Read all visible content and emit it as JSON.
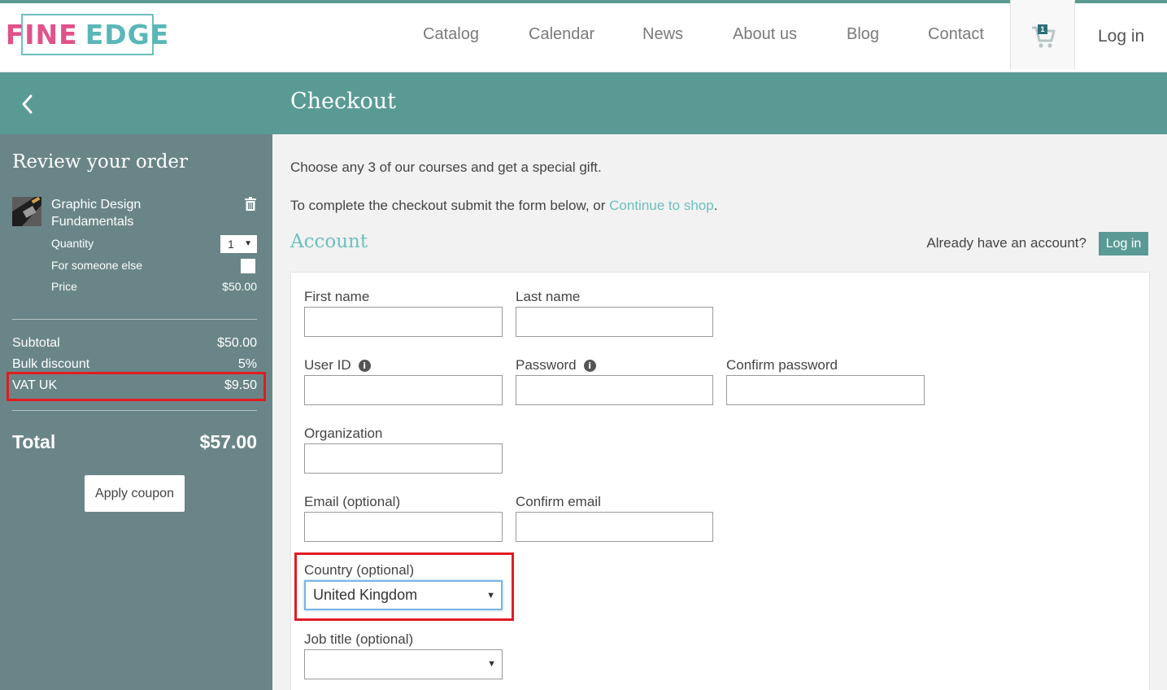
{
  "brand": {
    "part1": "FINE",
    "part2": "EDGE"
  },
  "nav": {
    "items": [
      "Catalog",
      "Calendar",
      "News",
      "About us",
      "Blog",
      "Contact"
    ],
    "cart_count": "1",
    "login": "Log in"
  },
  "banner": {
    "title": "Checkout"
  },
  "sidebar": {
    "title": "Review your order",
    "course": {
      "name": "Graphic Design Fundamentals"
    },
    "quantity_label": "Quantity",
    "quantity_value": "1",
    "someone_else_label": "For someone else",
    "price_label": "Price",
    "price_value": "$50.00",
    "subtotal_label": "Subtotal",
    "subtotal_value": "$50.00",
    "discount_label": "Bulk discount",
    "discount_value": "5%",
    "vat_label": "VAT UK",
    "vat_value": "$9.50",
    "total_label": "Total",
    "total_value": "$57.00",
    "coupon_button": "Apply coupon"
  },
  "main": {
    "promo": "Choose any 3 of our courses and get a special gift.",
    "instruction_prefix": "To complete the checkout submit the form below, or ",
    "instruction_link": "Continue to shop",
    "instruction_suffix": ".",
    "account_title": "Account",
    "already_text": "Already have an account?",
    "login_button": "Log in",
    "fields": {
      "first_name": "First name",
      "last_name": "Last name",
      "user_id": "User ID",
      "password": "Password",
      "confirm_password": "Confirm password",
      "organization": "Organization",
      "email": "Email (optional)",
      "confirm_email": "Confirm email",
      "country": "Country (optional)",
      "country_value": "United Kingdom",
      "job_title": "Job title (optional)",
      "job_title_value": ""
    }
  },
  "colors": {
    "teal": "#5a9a95",
    "sidebar": "#6a8587",
    "accent": "#6cc1bd",
    "logo_pink": "#e0528a",
    "highlight": "#e11c22"
  }
}
